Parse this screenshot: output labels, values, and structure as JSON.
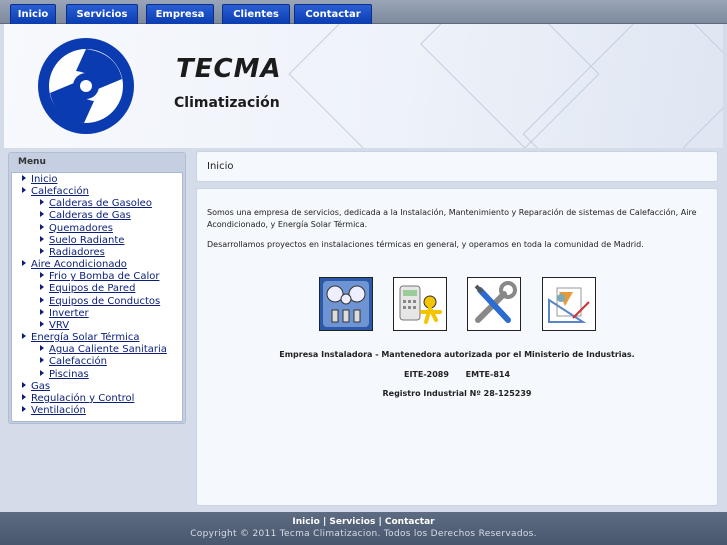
{
  "nav": {
    "tabs": [
      "Inicio",
      "Servicios",
      "Empresa",
      "Clientes",
      "Contactar"
    ]
  },
  "header": {
    "brand": "TECMA",
    "tagline": "Climatización"
  },
  "sidebar": {
    "title": "Menu",
    "items": [
      {
        "label": "Inicio",
        "level": 1
      },
      {
        "label": "Calefacción",
        "level": 1
      },
      {
        "label": "Calderas de Gasoleo",
        "level": 2
      },
      {
        "label": "Calderas de Gas",
        "level": 2
      },
      {
        "label": "Quemadores",
        "level": 2
      },
      {
        "label": "Suelo Radiante",
        "level": 2
      },
      {
        "label": "Radiadores",
        "level": 2
      },
      {
        "label": "Aire Acondicionado",
        "level": 1
      },
      {
        "label": "Frio y Bomba de Calor",
        "level": 2
      },
      {
        "label": "Equipos de Pared",
        "level": 2
      },
      {
        "label": "Equipos de Conductos",
        "level": 2
      },
      {
        "label": "Inverter",
        "level": 2
      },
      {
        "label": "VRV",
        "level": 2
      },
      {
        "label": "Energía Solar Térmica",
        "level": 1
      },
      {
        "label": "Agua Caliente Sanitaria",
        "level": 2
      },
      {
        "label": "Calefacción",
        "level": 2
      },
      {
        "label": "Piscinas",
        "level": 2
      },
      {
        "label": "Gas",
        "level": 1
      },
      {
        "label": "Regulación y Control",
        "level": 1
      },
      {
        "label": "Ventilación",
        "level": 1
      }
    ]
  },
  "breadcrumb": "Inicio",
  "content": {
    "para1": "Somos una empresa de servicios, dedicada a la Instalación, Mantenimiento y Reparación de sistemas de Calefacción, Aire Acondicionado, y Energía Solar Térmica.",
    "para2": "Desarrollamos proyectos en instalaciones térmicas en general, y operamos en toda la comunidad de Madrid.",
    "icons": [
      "gauges-icon",
      "contact-icon",
      "tools-icon",
      "design-icon"
    ],
    "cert": "Empresa Instaladora - Mantenedora autorizada por el Ministerio de Industrias.",
    "codes": "EITE-2089      EMTE-814",
    "registro": "Registro Industrial Nº 28-125239"
  },
  "footer": {
    "links": [
      "Inicio",
      "Servicios",
      "Contactar"
    ],
    "copyright": "Copyright © 2011 Tecma Climatizacion. Todos los Derechos Reservados."
  },
  "colors": {
    "tab": "#1a4fc8",
    "link": "#0a1e7a",
    "logo": "#0b3bb0",
    "footer": "#52607a"
  }
}
